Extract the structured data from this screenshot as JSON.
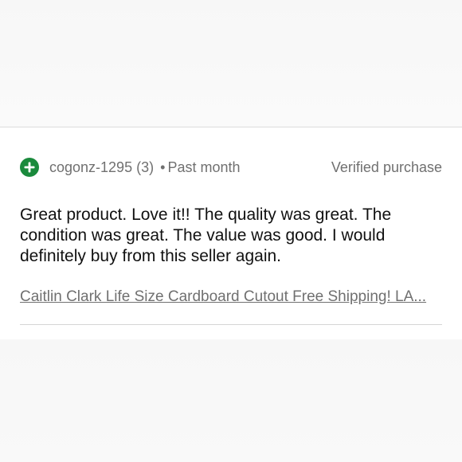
{
  "review": {
    "rating_icon": "plus-circle-icon",
    "rating_color": "#1a8a3c",
    "username": "cogonz-1295",
    "feedback_score": "(3)",
    "separator": "•",
    "time": "Past month",
    "verified_label": "Verified purchase",
    "body": "Great product. Love it!! The quality was great. The condition was great. The value was good. I would definitely buy from this seller again.",
    "item_title": "Caitlin Clark Life Size Cardboard Cutout Free Shipping! LA..."
  }
}
